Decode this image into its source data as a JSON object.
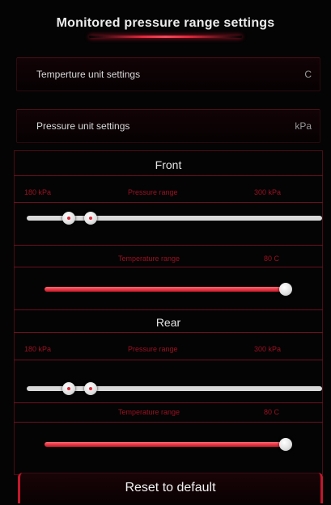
{
  "header": {
    "title": "Monitored pressure range settings"
  },
  "settings": {
    "temperature_unit": {
      "label": "Temperture unit settings",
      "value": "C"
    },
    "pressure_unit": {
      "label": "Pressure unit settings",
      "value": "kPa"
    }
  },
  "front": {
    "title": "Front",
    "pressure_min": "180 kPa",
    "pressure_label": "Pressure range",
    "pressure_max": "300 kPa",
    "temperature_label": "Temperature range",
    "temperature_value": "80 C"
  },
  "rear": {
    "title": "Rear",
    "pressure_min": "180 kPa",
    "pressure_label": "Pressure range",
    "pressure_max": "300 kPa",
    "temperature_label": "Temperature range",
    "temperature_value": "80 C"
  },
  "footer": {
    "reset_label": "Reset to default"
  },
  "colors": {
    "accent": "#e3323f",
    "background": "#040404",
    "track_grey": "#d9d9d9"
  },
  "icons": {
    "slider_handle": "circle-knob",
    "slider_handle_active": "circle-knob-red-dot"
  }
}
